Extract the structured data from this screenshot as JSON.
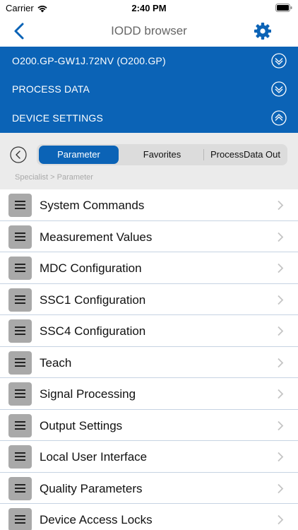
{
  "status_bar": {
    "carrier": "Carrier",
    "time": "2:40 PM"
  },
  "nav": {
    "title": "IODD browser",
    "back_icon": "chevron-left-icon",
    "settings_icon": "gear-icon"
  },
  "device_panel": {
    "color": "#0b63b6",
    "rows": [
      {
        "label": "O200.GP-GW1J.72NV (O200.GP)",
        "state": "expand"
      },
      {
        "label": "PROCESS DATA",
        "state": "expand"
      },
      {
        "label": "DEVICE SETTINGS",
        "state": "collapse"
      }
    ]
  },
  "tabs": {
    "items": [
      "Parameter",
      "Favorites",
      "ProcessData Out"
    ],
    "selected": "Parameter"
  },
  "breadcrumb": "Specialist > Parameter",
  "menu": {
    "items": [
      "System Commands",
      "Measurement Values",
      "MDC Configuration",
      "SSC1 Configuration",
      "SSC4 Configuration",
      "Teach",
      "Signal Processing",
      "Output Settings",
      "Local User Interface",
      "Quality Parameters",
      "Device Access Locks"
    ]
  }
}
